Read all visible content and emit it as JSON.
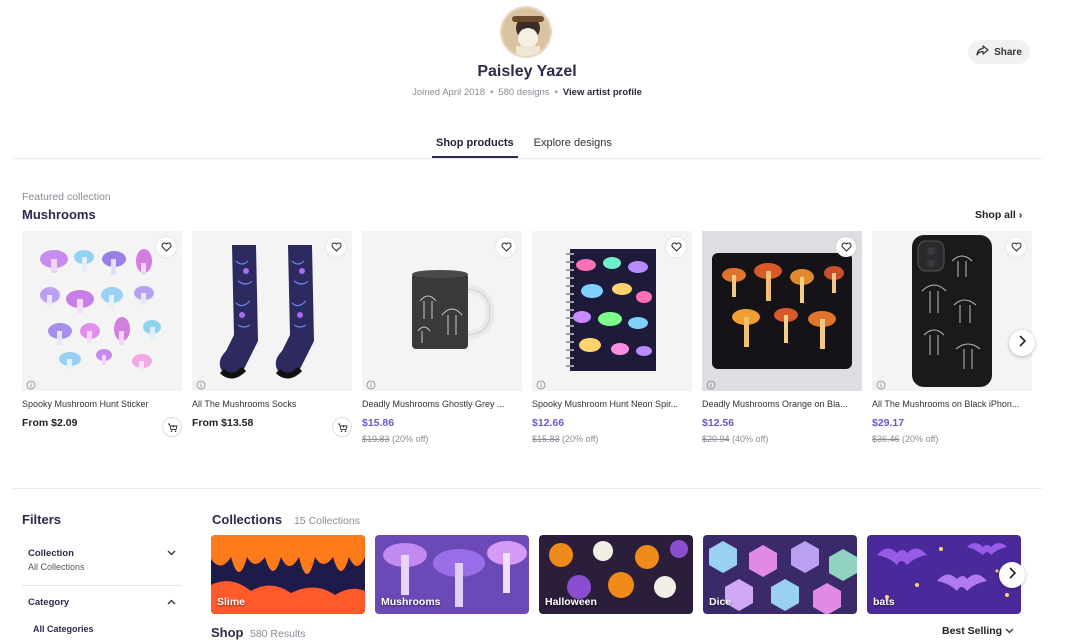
{
  "profile": {
    "name": "Paisley Yazel",
    "joined": "Joined April 2018",
    "designs": "580 designs",
    "view_profile": "View artist profile",
    "share_label": "Share"
  },
  "tabs": [
    {
      "label": "Shop products",
      "active": true
    },
    {
      "label": "Explore designs",
      "active": false
    }
  ],
  "featured": {
    "label": "Featured collection",
    "title": "Mushrooms",
    "shop_all": "Shop all",
    "products": [
      {
        "name": "Spooky Mushroom Hunt Sticker",
        "price": "From $2.09",
        "old_price": "",
        "discount": "",
        "cart": true
      },
      {
        "name": "All The Mushrooms Socks",
        "price": "From $13.58",
        "old_price": "",
        "discount": "",
        "cart": true
      },
      {
        "name": "Deadly Mushrooms Ghostly Grey ...",
        "price": "$15.86",
        "old_price": "$19.83",
        "discount": "(20% off)",
        "cart": false
      },
      {
        "name": "Spooky Mushroom Hunt Neon Spir...",
        "price": "$12.66",
        "old_price": "$15.83",
        "discount": "(20% off)",
        "cart": false
      },
      {
        "name": "Deadly Mushrooms Orange on Bla...",
        "price": "$12.56",
        "old_price": "$20.94",
        "discount": "(40% off)",
        "cart": false
      },
      {
        "name": "All The Mushrooms on Black iPhon...",
        "price": "$29.17",
        "old_price": "$36.46",
        "discount": "(20% off)",
        "cart": false
      }
    ]
  },
  "filters": {
    "title": "Filters",
    "collection_label": "Collection",
    "collection_value": "All Collections",
    "category_label": "Category",
    "category_value": "All Categories"
  },
  "collections": {
    "title": "Collections",
    "count": "15 Collections",
    "items": [
      "Slime",
      "Mushrooms",
      "Halloween",
      "Dice",
      "bats"
    ]
  },
  "shop": {
    "title": "Shop",
    "count": "580 Results",
    "sort": "Best Selling"
  },
  "colors": {
    "accent": "#6f56c9",
    "heading": "#2d2a4a"
  }
}
